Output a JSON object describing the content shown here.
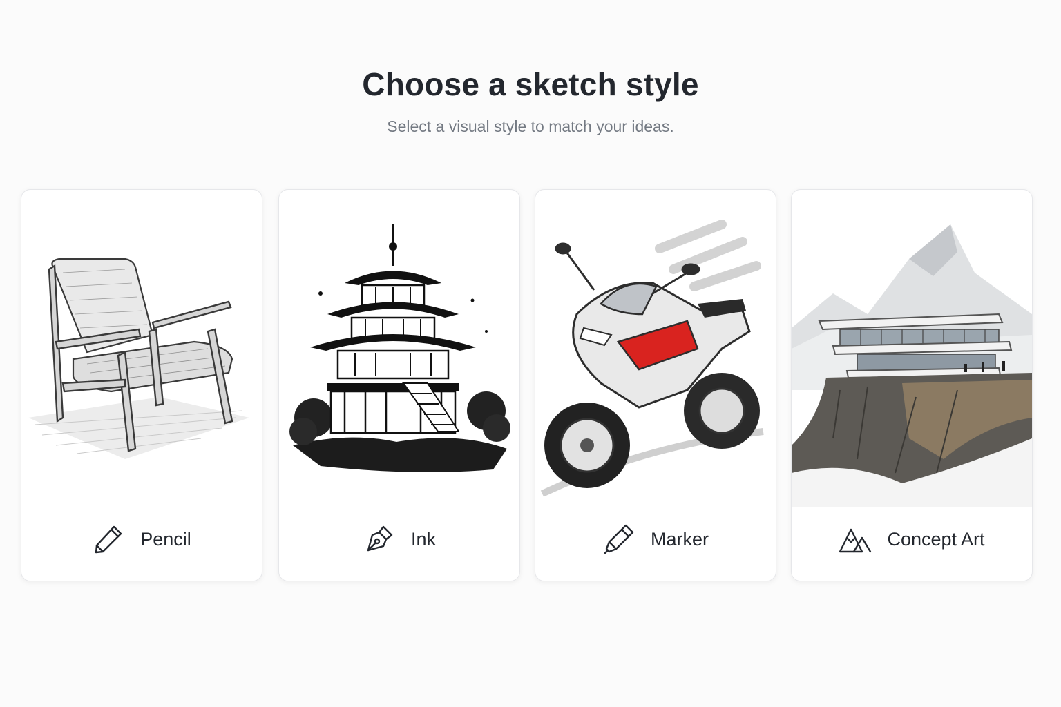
{
  "header": {
    "title": "Choose a sketch style",
    "subtitle": "Select a visual style to match your ideas."
  },
  "styles": [
    {
      "label": "Pencil",
      "icon": "pencil-icon",
      "illustration": "armchair-pencil-sketch"
    },
    {
      "label": "Ink",
      "icon": "fountain-pen-icon",
      "illustration": "pagoda-ink-drawing"
    },
    {
      "label": "Marker",
      "icon": "marker-icon",
      "illustration": "motorcycle-marker-sketch"
    },
    {
      "label": "Concept Art",
      "icon": "mountain-icon",
      "illustration": "cliff-building-concept-art"
    }
  ],
  "colors": {
    "background": "#fbfbfb",
    "card": "#ffffff",
    "title": "#23272e",
    "subtitle": "#737982",
    "accent_red": "#d9231f"
  }
}
